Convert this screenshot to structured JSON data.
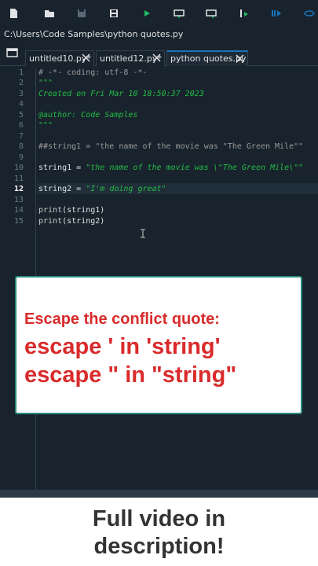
{
  "toolbar": {
    "icons": [
      "new-file-icon",
      "open-folder-icon",
      "save-icon",
      "save-all-icon",
      "run-icon",
      "run-cell-icon",
      "run-cell-advance-icon",
      "run-selection-icon",
      "debug-icon",
      "maximize-icon"
    ],
    "accent": "#1a72bb"
  },
  "path": "C:\\Users\\Code Samples\\python quotes.py",
  "tabs": [
    {
      "label": "untitled10.py*",
      "active": false
    },
    {
      "label": "untitled12.py*",
      "active": false
    },
    {
      "label": "python quotes.py",
      "active": true
    }
  ],
  "editor": {
    "line_numbers": [
      "1",
      "2",
      "3",
      "4",
      "5",
      "6",
      "7",
      "8",
      "9",
      "10",
      "11",
      "12",
      "13",
      "14",
      "15"
    ],
    "current_line": "12",
    "lines": {
      "l1": "# -*- coding: utf-8 -*-",
      "l2": "\"\"\"",
      "l3": "Created on Fri Mar 10 18:50:37 2023",
      "l5": "@author: Code Samples",
      "l6": "\"\"\"",
      "l8": "##string1 = \"the name of the movie was \"The Green Mile\"\"",
      "l10_var": "string1 = ",
      "l10_str": "\"the name of the movie was \\\"The Green Mile\\\"\"",
      "l12_var": "string2 = ",
      "l12_str": "\"I'm doing great\"",
      "l14_fn": "print",
      "l14_arg": "(string1)",
      "l15_fn": "print",
      "l15_arg": "(string2)"
    }
  },
  "overlay": {
    "line1": "Escape the conflict quote:",
    "line2": "escape ' in 'string'",
    "line3": "escape \" in \"string\"",
    "color": "#d92b2b"
  },
  "footer": {
    "line1": "Full video in",
    "line2": "description!"
  }
}
